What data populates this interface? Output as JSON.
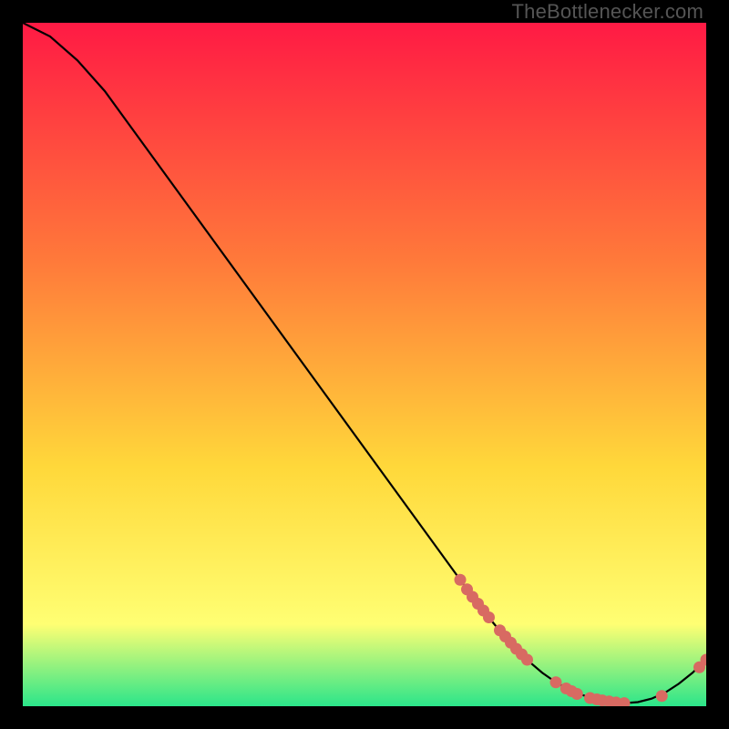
{
  "watermark": "TheBottlenecker.com",
  "colors": {
    "gradient_top": "#ff1a44",
    "gradient_mid1": "#ff7a3a",
    "gradient_mid2": "#ffd83a",
    "gradient_low": "#ffff73",
    "gradient_bottom": "#2be58a",
    "frame": "#000000",
    "line": "#000000",
    "marker": "#d86a62"
  },
  "chart_data": {
    "type": "line",
    "title": "",
    "xlabel": "",
    "ylabel": "",
    "xlim": [
      0,
      100
    ],
    "ylim": [
      0,
      100
    ],
    "series": [
      {
        "name": "curve",
        "x": [
          0,
          4,
          8,
          12,
          16,
          20,
          24,
          28,
          32,
          36,
          40,
          44,
          48,
          52,
          56,
          60,
          64,
          66,
          68,
          70,
          72,
          74,
          76,
          78,
          80,
          82,
          84,
          86,
          88,
          90,
          92,
          94,
          96,
          98,
          100
        ],
        "y": [
          100,
          98,
          94.5,
          90,
          84.5,
          79,
          73.5,
          68,
          62.5,
          57,
          51.5,
          46,
          40.5,
          35,
          29.5,
          24,
          18.5,
          15.8,
          13.2,
          10.8,
          8.6,
          6.6,
          4.9,
          3.5,
          2.4,
          1.6,
          1.0,
          0.6,
          0.45,
          0.6,
          1.1,
          2.0,
          3.3,
          4.9,
          6.8
        ]
      }
    ],
    "markers": [
      {
        "x": 64.0,
        "y": 18.5
      },
      {
        "x": 65.0,
        "y": 17.1
      },
      {
        "x": 65.8,
        "y": 16.0
      },
      {
        "x": 66.6,
        "y": 15.0
      },
      {
        "x": 67.4,
        "y": 14.0
      },
      {
        "x": 68.2,
        "y": 13.0
      },
      {
        "x": 69.8,
        "y": 11.1
      },
      {
        "x": 70.6,
        "y": 10.2
      },
      {
        "x": 71.4,
        "y": 9.3
      },
      {
        "x": 72.2,
        "y": 8.4
      },
      {
        "x": 73.0,
        "y": 7.6
      },
      {
        "x": 73.8,
        "y": 6.8
      },
      {
        "x": 78.0,
        "y": 3.5
      },
      {
        "x": 79.5,
        "y": 2.6
      },
      {
        "x": 80.3,
        "y": 2.2
      },
      {
        "x": 81.1,
        "y": 1.8
      },
      {
        "x": 83.0,
        "y": 1.2
      },
      {
        "x": 84.0,
        "y": 1.0
      },
      {
        "x": 84.8,
        "y": 0.85
      },
      {
        "x": 85.8,
        "y": 0.7
      },
      {
        "x": 86.8,
        "y": 0.55
      },
      {
        "x": 88.0,
        "y": 0.45
      },
      {
        "x": 93.5,
        "y": 1.5
      },
      {
        "x": 99.0,
        "y": 5.7
      },
      {
        "x": 100.0,
        "y": 6.8
      }
    ]
  }
}
